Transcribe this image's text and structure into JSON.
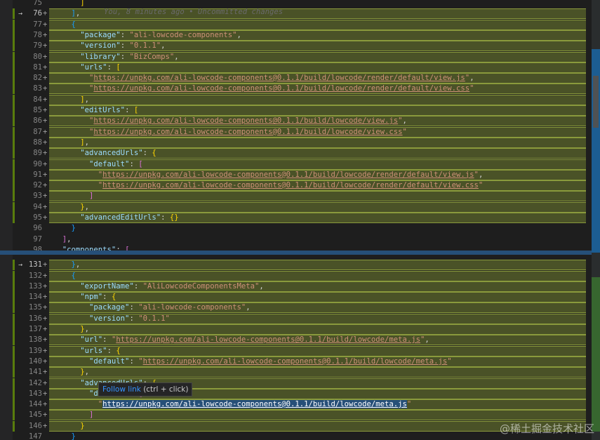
{
  "editor": {
    "blame_text": "You, 8 minutes ago • Uncommitted changes",
    "tooltip": {
      "link_label": "Follow link",
      "shortcut": "(ctrl + click)"
    },
    "watermark": "@稀土掘金技术社区",
    "colors": {
      "added_line_bg": "#4a5227",
      "added_line_border": "#8a9a3c",
      "gutter_added": "#587c0c",
      "key": "#9cdcfe",
      "string": "#ce9178",
      "selection": "#264f78",
      "bracket_pink": "#da70d6",
      "bracket_blue": "#179fff",
      "bracket_yellow": "#ffd700"
    },
    "lines": [
      {
        "n": "75",
        "m": "",
        "added": false,
        "cur": false,
        "t": [
          [
            "      ",
            "p"
          ],
          [
            "]",
            "b3"
          ]
        ]
      },
      {
        "n": "76",
        "m": "+",
        "added": true,
        "cur": true,
        "t": [
          [
            "    ",
            "p"
          ],
          [
            "]",
            "b2"
          ],
          [
            ",",
            "p"
          ]
        ]
      },
      {
        "n": "77",
        "m": "+",
        "added": true,
        "cur": false,
        "t": [
          [
            "    ",
            "p"
          ],
          [
            "{",
            "b2"
          ]
        ]
      },
      {
        "n": "78",
        "m": "+",
        "added": true,
        "cur": false,
        "t": [
          [
            "      ",
            "p"
          ],
          [
            "\"package\"",
            "k"
          ],
          [
            ": ",
            "p"
          ],
          [
            "\"ali-lowcode-components\"",
            "s"
          ],
          [
            ",",
            "p"
          ]
        ]
      },
      {
        "n": "79",
        "m": "+",
        "added": true,
        "cur": false,
        "t": [
          [
            "      ",
            "p"
          ],
          [
            "\"version\"",
            "k"
          ],
          [
            ": ",
            "p"
          ],
          [
            "\"0.1.1\"",
            "s"
          ],
          [
            ",",
            "p"
          ]
        ]
      },
      {
        "n": "80",
        "m": "+",
        "added": true,
        "cur": false,
        "t": [
          [
            "      ",
            "p"
          ],
          [
            "\"library\"",
            "k"
          ],
          [
            ": ",
            "p"
          ],
          [
            "\"BizComps\"",
            "s"
          ],
          [
            ",",
            "p"
          ]
        ]
      },
      {
        "n": "81",
        "m": "+",
        "added": true,
        "cur": false,
        "t": [
          [
            "      ",
            "p"
          ],
          [
            "\"urls\"",
            "k"
          ],
          [
            ": ",
            "p"
          ],
          [
            "[",
            "b3"
          ]
        ]
      },
      {
        "n": "82",
        "m": "+",
        "added": true,
        "cur": false,
        "t": [
          [
            "        ",
            "p"
          ],
          [
            "\"",
            "s"
          ],
          [
            "https://unpkg.com/ali-lowcode-components@0.1.1/build/lowcode/render/default/view.js",
            "u"
          ],
          [
            "\"",
            "s"
          ],
          [
            ",",
            "p"
          ]
        ]
      },
      {
        "n": "83",
        "m": "+",
        "added": true,
        "cur": false,
        "t": [
          [
            "        ",
            "p"
          ],
          [
            "\"",
            "s"
          ],
          [
            "https://unpkg.com/ali-lowcode-components@0.1.1/build/lowcode/render/default/view.css",
            "u"
          ],
          [
            "\"",
            "s"
          ]
        ]
      },
      {
        "n": "84",
        "m": "+",
        "added": true,
        "cur": false,
        "t": [
          [
            "      ",
            "p"
          ],
          [
            "]",
            "b3"
          ],
          [
            ",",
            "p"
          ]
        ]
      },
      {
        "n": "85",
        "m": "+",
        "added": true,
        "cur": false,
        "t": [
          [
            "      ",
            "p"
          ],
          [
            "\"editUrls\"",
            "k"
          ],
          [
            ": ",
            "p"
          ],
          [
            "[",
            "b3"
          ]
        ]
      },
      {
        "n": "86",
        "m": "+",
        "added": true,
        "cur": false,
        "t": [
          [
            "        ",
            "p"
          ],
          [
            "\"",
            "s"
          ],
          [
            "https://unpkg.com/ali-lowcode-components@0.1.1/build/lowcode/view.js",
            "u"
          ],
          [
            "\"",
            "s"
          ],
          [
            ",",
            "p"
          ]
        ]
      },
      {
        "n": "87",
        "m": "+",
        "added": true,
        "cur": false,
        "t": [
          [
            "        ",
            "p"
          ],
          [
            "\"",
            "s"
          ],
          [
            "https://unpkg.com/ali-lowcode-components@0.1.1/build/lowcode/view.css",
            "u"
          ],
          [
            "\"",
            "s"
          ]
        ]
      },
      {
        "n": "88",
        "m": "+",
        "added": true,
        "cur": false,
        "t": [
          [
            "      ",
            "p"
          ],
          [
            "]",
            "b3"
          ],
          [
            ",",
            "p"
          ]
        ]
      },
      {
        "n": "89",
        "m": "+",
        "added": true,
        "cur": false,
        "t": [
          [
            "      ",
            "p"
          ],
          [
            "\"advancedUrls\"",
            "k"
          ],
          [
            ": ",
            "p"
          ],
          [
            "{",
            "b3"
          ]
        ]
      },
      {
        "n": "90",
        "m": "+",
        "added": true,
        "cur": false,
        "t": [
          [
            "        ",
            "p"
          ],
          [
            "\"default\"",
            "k"
          ],
          [
            ": ",
            "p"
          ],
          [
            "[",
            "b1"
          ]
        ]
      },
      {
        "n": "91",
        "m": "+",
        "added": true,
        "cur": false,
        "t": [
          [
            "          ",
            "p"
          ],
          [
            "\"",
            "s"
          ],
          [
            "https://unpkg.com/ali-lowcode-components@0.1.1/build/lowcode/render/default/view.js",
            "u"
          ],
          [
            "\"",
            "s"
          ],
          [
            ",",
            "p"
          ]
        ]
      },
      {
        "n": "92",
        "m": "+",
        "added": true,
        "cur": false,
        "t": [
          [
            "          ",
            "p"
          ],
          [
            "\"",
            "s"
          ],
          [
            "https://unpkg.com/ali-lowcode-components@0.1.1/build/lowcode/render/default/view.css",
            "u"
          ],
          [
            "\"",
            "s"
          ]
        ]
      },
      {
        "n": "93",
        "m": "+",
        "added": true,
        "cur": false,
        "t": [
          [
            "        ",
            "p"
          ],
          [
            "]",
            "b1"
          ]
        ]
      },
      {
        "n": "94",
        "m": "+",
        "added": true,
        "cur": false,
        "t": [
          [
            "      ",
            "p"
          ],
          [
            "}",
            "b3"
          ],
          [
            ",",
            "p"
          ]
        ]
      },
      {
        "n": "95",
        "m": "+",
        "added": true,
        "cur": false,
        "t": [
          [
            "      ",
            "p"
          ],
          [
            "\"advancedEditUrls\"",
            "k"
          ],
          [
            ": ",
            "p"
          ],
          [
            "{}",
            "b3"
          ]
        ]
      },
      {
        "n": "96",
        "m": "",
        "added": false,
        "cur": false,
        "t": [
          [
            "    ",
            "p"
          ],
          [
            "}",
            "b2"
          ]
        ]
      },
      {
        "n": "97",
        "m": "",
        "added": false,
        "cur": false,
        "t": [
          [
            "  ",
            "p"
          ],
          [
            "]",
            "b1"
          ],
          [
            ",",
            "p"
          ]
        ]
      },
      {
        "n": "98",
        "m": "",
        "added": false,
        "cur": false,
        "t": [
          [
            "  ",
            "p"
          ],
          [
            "\"components\"",
            "k"
          ],
          [
            ": ",
            "p"
          ],
          [
            "[",
            "b1"
          ]
        ]
      },
      {
        "n": "131",
        "m": "+",
        "added": true,
        "cur": true,
        "t": [
          [
            "    ",
            "p"
          ],
          [
            "}",
            "b2"
          ],
          [
            ",",
            "p"
          ]
        ]
      },
      {
        "n": "132",
        "m": "+",
        "added": true,
        "cur": false,
        "t": [
          [
            "    ",
            "p"
          ],
          [
            "{",
            "b2"
          ]
        ]
      },
      {
        "n": "133",
        "m": "+",
        "added": true,
        "cur": false,
        "t": [
          [
            "      ",
            "p"
          ],
          [
            "\"exportName\"",
            "k"
          ],
          [
            ": ",
            "p"
          ],
          [
            "\"AliLowcodeComponentsMeta\"",
            "s"
          ],
          [
            ",",
            "p"
          ]
        ]
      },
      {
        "n": "134",
        "m": "+",
        "added": true,
        "cur": false,
        "t": [
          [
            "      ",
            "p"
          ],
          [
            "\"npm\"",
            "k"
          ],
          [
            ": ",
            "p"
          ],
          [
            "{",
            "b3"
          ]
        ]
      },
      {
        "n": "135",
        "m": "+",
        "added": true,
        "cur": false,
        "t": [
          [
            "        ",
            "p"
          ],
          [
            "\"package\"",
            "k"
          ],
          [
            ": ",
            "p"
          ],
          [
            "\"ali-lowcode-components\"",
            "s"
          ],
          [
            ",",
            "p"
          ]
        ]
      },
      {
        "n": "136",
        "m": "+",
        "added": true,
        "cur": false,
        "t": [
          [
            "        ",
            "p"
          ],
          [
            "\"version\"",
            "k"
          ],
          [
            ": ",
            "p"
          ],
          [
            "\"0.1.1\"",
            "s"
          ]
        ]
      },
      {
        "n": "137",
        "m": "+",
        "added": true,
        "cur": false,
        "t": [
          [
            "      ",
            "p"
          ],
          [
            "}",
            "b3"
          ],
          [
            ",",
            "p"
          ]
        ]
      },
      {
        "n": "138",
        "m": "+",
        "added": true,
        "cur": false,
        "t": [
          [
            "      ",
            "p"
          ],
          [
            "\"url\"",
            "k"
          ],
          [
            ": ",
            "p"
          ],
          [
            "\"",
            "s"
          ],
          [
            "https://unpkg.com/ali-lowcode-components@0.1.1/build/lowcode/meta.js",
            "u"
          ],
          [
            "\"",
            "s"
          ],
          [
            ",",
            "p"
          ]
        ]
      },
      {
        "n": "139",
        "m": "+",
        "added": true,
        "cur": false,
        "t": [
          [
            "      ",
            "p"
          ],
          [
            "\"urls\"",
            "k"
          ],
          [
            ": ",
            "p"
          ],
          [
            "{",
            "b3"
          ]
        ]
      },
      {
        "n": "140",
        "m": "+",
        "added": true,
        "cur": false,
        "t": [
          [
            "        ",
            "p"
          ],
          [
            "\"default\"",
            "k"
          ],
          [
            ": ",
            "p"
          ],
          [
            "\"",
            "s"
          ],
          [
            "https://unpkg.com/ali-lowcode-components@0.1.1/build/lowcode/meta.js",
            "u"
          ],
          [
            "\"",
            "s"
          ]
        ]
      },
      {
        "n": "141",
        "m": "+",
        "added": true,
        "cur": false,
        "t": [
          [
            "      ",
            "p"
          ],
          [
            "}",
            "b3"
          ],
          [
            ",",
            "p"
          ]
        ]
      },
      {
        "n": "142",
        "m": "+",
        "added": true,
        "cur": false,
        "t": [
          [
            "      ",
            "p"
          ],
          [
            "\"advancedUrls\"",
            "k"
          ],
          [
            ": ",
            "p"
          ],
          [
            "{",
            "b3"
          ]
        ]
      },
      {
        "n": "143",
        "m": "+",
        "added": true,
        "cur": false,
        "t": [
          [
            "        ",
            "p"
          ],
          [
            "\"default\"",
            "k"
          ],
          [
            ": ",
            "p"
          ],
          [
            "[",
            "b1"
          ]
        ]
      },
      {
        "n": "144",
        "m": "+",
        "added": true,
        "cur": false,
        "t": [
          [
            "          ",
            "p"
          ],
          [
            "\"",
            "s"
          ],
          [
            "https://unpkg.com/ali-lowcode-components@0.1.1/build/lowcode/meta.js",
            "sel"
          ],
          [
            "\"",
            "s"
          ]
        ]
      },
      {
        "n": "145",
        "m": "+",
        "added": true,
        "cur": false,
        "t": [
          [
            "        ",
            "p"
          ],
          [
            "]",
            "b1"
          ]
        ]
      },
      {
        "n": "146",
        "m": "+",
        "added": true,
        "cur": false,
        "t": [
          [
            "      ",
            "p"
          ],
          [
            "}",
            "b3"
          ]
        ]
      },
      {
        "n": "147",
        "m": "",
        "added": false,
        "cur": false,
        "t": [
          [
            "    ",
            "p"
          ],
          [
            "}",
            "b2"
          ]
        ]
      }
    ]
  }
}
